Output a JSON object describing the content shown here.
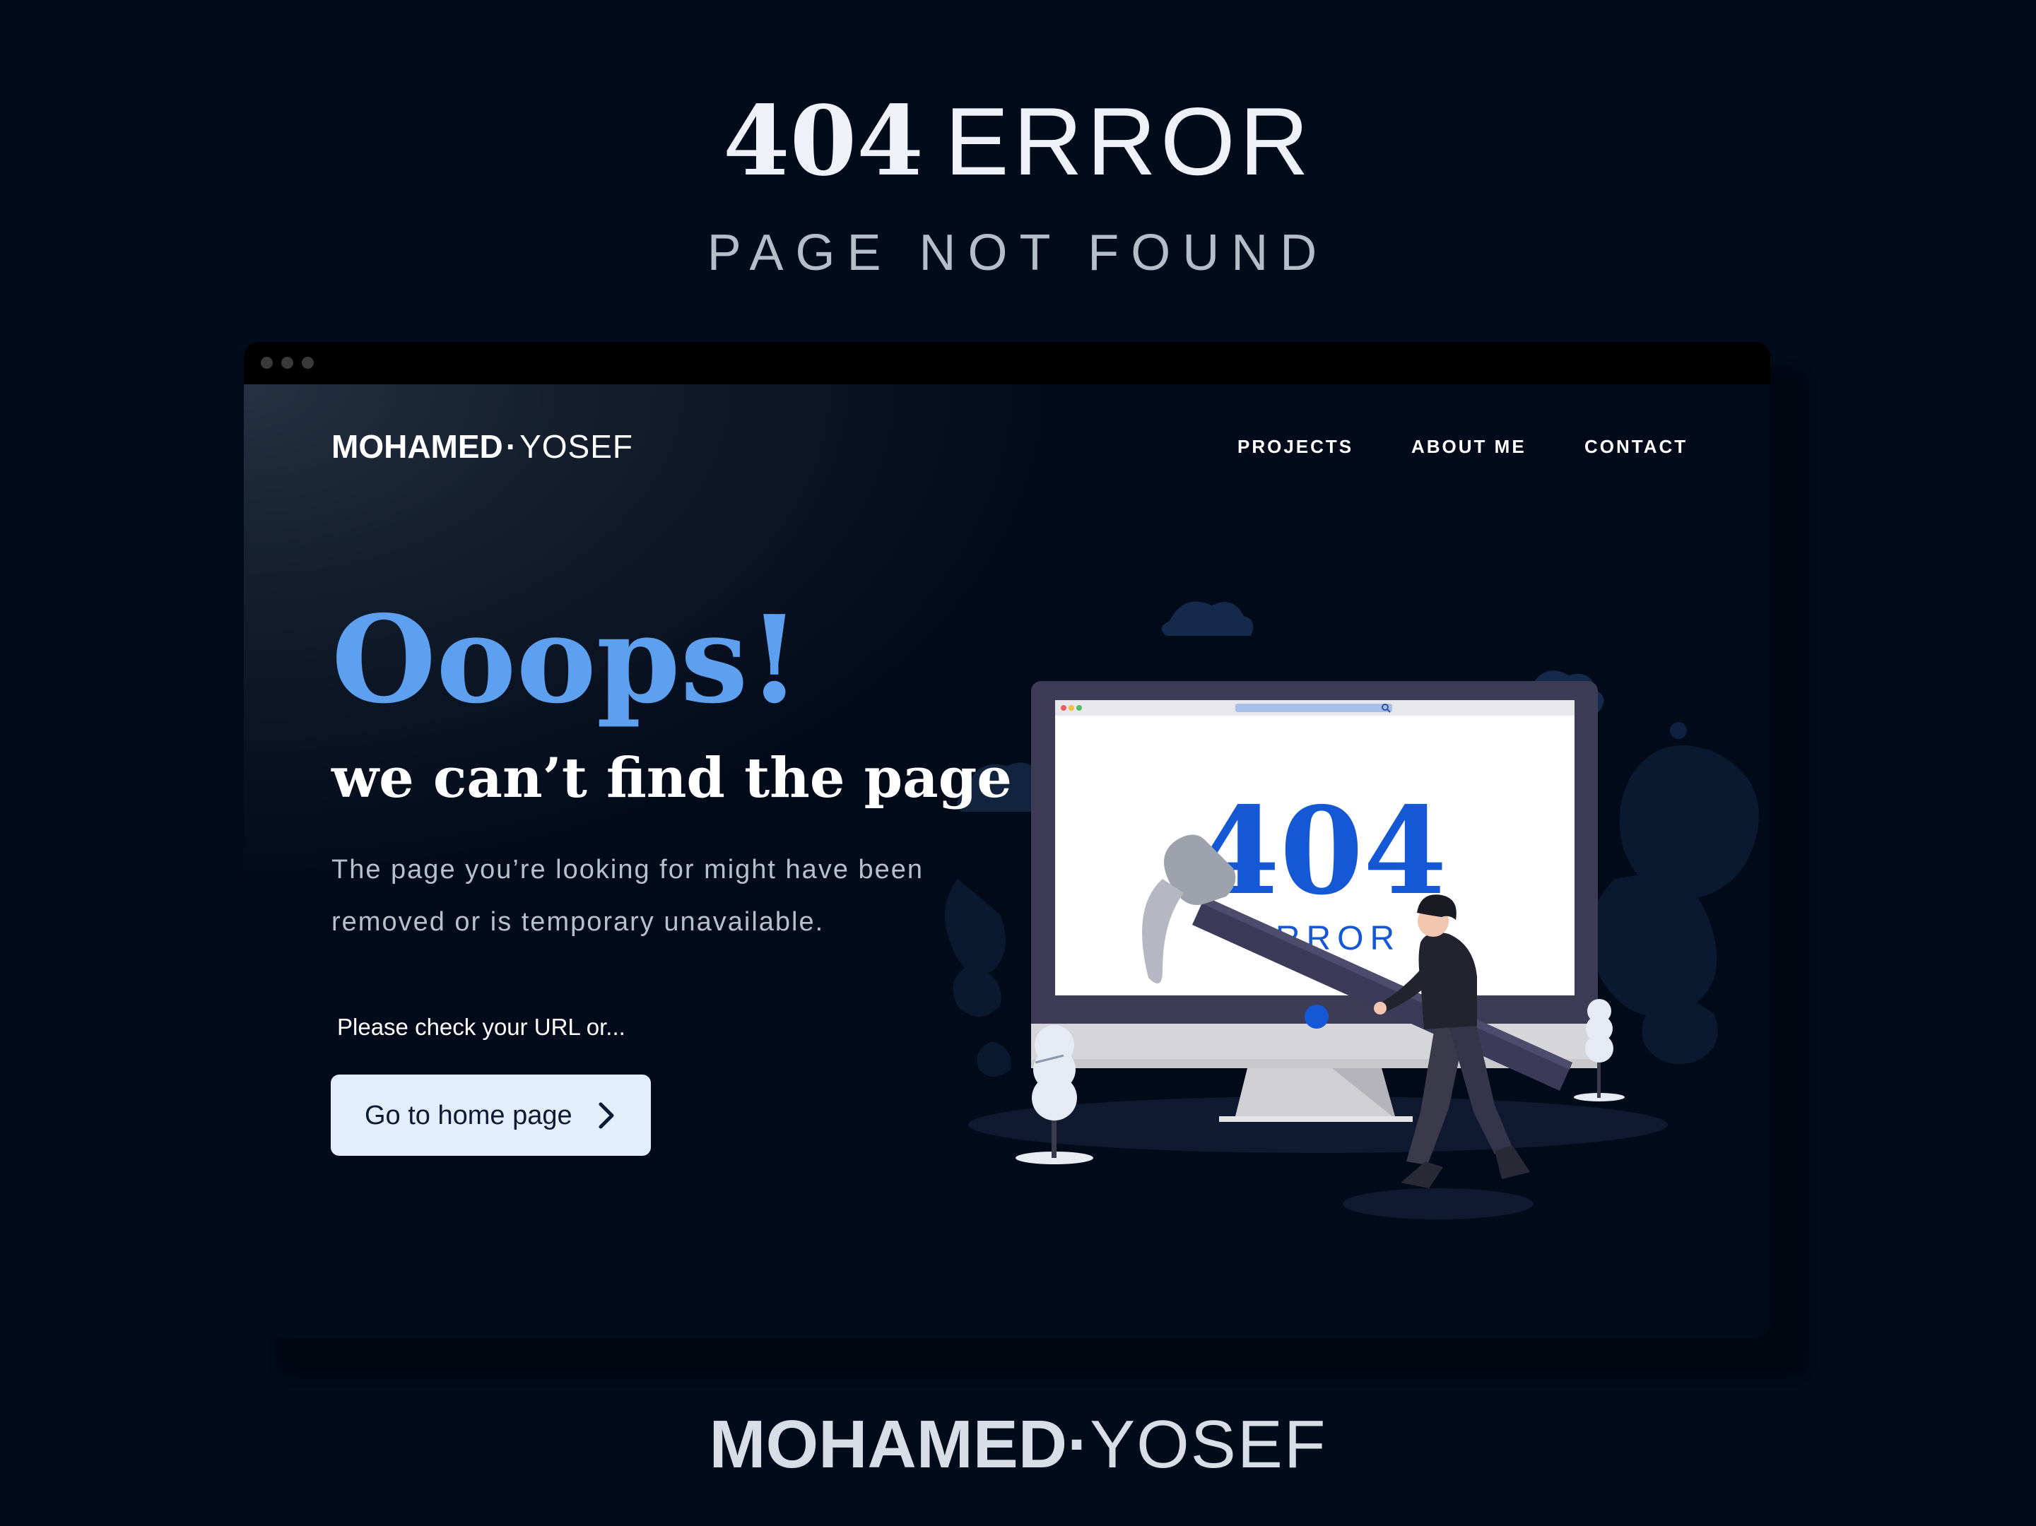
{
  "poster": {
    "title_number": "404",
    "title_word": "ERROR",
    "subtitle": "PAGE NOT FOUND",
    "footer_brand_bold": "MOHAMED",
    "footer_brand_sep": "·",
    "footer_brand_thin": "YOSEF"
  },
  "site": {
    "brand_bold": "MOHAMED",
    "brand_sep": "·",
    "brand_thin": "YOSEF",
    "nav": [
      "PROJECTS",
      "ABOUT ME",
      "CONTACT"
    ]
  },
  "hero": {
    "oops": "Ooops!",
    "headline": "we can’t find the page",
    "description": "The page you’re looking for might have been removed or is temporary unavailable.",
    "check_text": "Please check your URL or...",
    "button_label": "Go to home page"
  },
  "illustration": {
    "screen_number": "404",
    "screen_word": "ERROR"
  },
  "colors": {
    "background": "#020b1a",
    "accent_blue": "#5ea0f0",
    "button_bg": "#e3eefd",
    "screen_number": "#1558d6"
  },
  "icons": [
    "browser-dots-icon",
    "chevron-right-icon",
    "search-icon",
    "hammer-icon"
  ]
}
